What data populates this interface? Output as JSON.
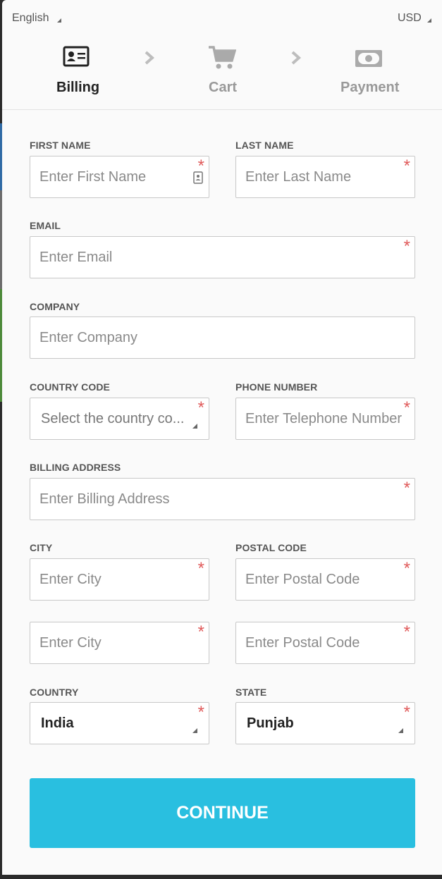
{
  "topbar": {
    "language": "English",
    "currency": "USD"
  },
  "steps": [
    {
      "label": "Billing",
      "icon": "id-card-icon",
      "active": true
    },
    {
      "label": "Cart",
      "icon": "cart-icon",
      "active": false
    },
    {
      "label": "Payment",
      "icon": "money-icon",
      "active": false
    }
  ],
  "form": {
    "first_name": {
      "label": "FIRST NAME",
      "placeholder": "Enter First Name"
    },
    "last_name": {
      "label": "LAST NAME",
      "placeholder": "Enter Last Name"
    },
    "email": {
      "label": "EMAIL",
      "placeholder": "Enter Email"
    },
    "company": {
      "label": "COMPANY",
      "placeholder": "Enter Company"
    },
    "country_code": {
      "label": "COUNTRY CODE",
      "placeholder": "Select the country co..."
    },
    "phone": {
      "label": "PHONE NUMBER",
      "placeholder": "Enter Telephone Number"
    },
    "billing_address": {
      "label": "BILLING ADDRESS",
      "placeholder": "Enter Billing Address"
    },
    "city": {
      "label": "CITY",
      "placeholder": "Enter City"
    },
    "postal_code": {
      "label": "POSTAL CODE",
      "placeholder": "Enter Postal Code"
    },
    "city2": {
      "placeholder": "Enter City"
    },
    "postal_code2": {
      "placeholder": "Enter Postal Code"
    },
    "country": {
      "label": "COUNTRY",
      "value": "India"
    },
    "state": {
      "label": "STATE",
      "value": "Punjab"
    },
    "required_mark": "*"
  },
  "continue_label": "CONTINUE",
  "colors": {
    "accent": "#29bfe0",
    "required": "#e05a5a",
    "active_step": "#222222",
    "inactive_step": "#999999"
  }
}
